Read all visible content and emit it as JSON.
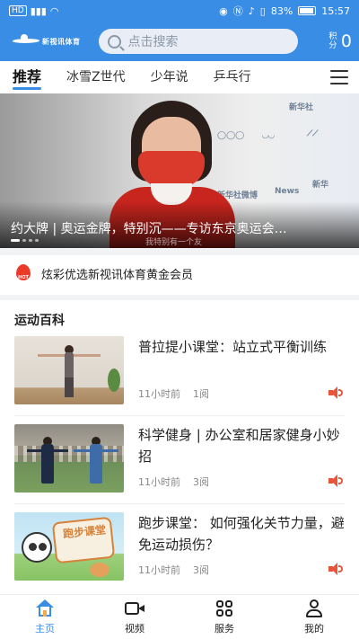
{
  "status_bar": {
    "left_icons": "HD",
    "battery": "83%",
    "time": "15:57"
  },
  "header": {
    "logo_text": "新视讯体育",
    "search_placeholder": "点击搜索",
    "points_label": "积分",
    "points_value": "0"
  },
  "tabs": [
    {
      "label": "推荐",
      "active": true
    },
    {
      "label": "冰雪Z世代",
      "active": false
    },
    {
      "label": "少年说",
      "active": false
    },
    {
      "label": "乒乓行",
      "active": false
    }
  ],
  "banner": {
    "title": "约大牌 | 奥运金牌，特别沉——专访东京奥运会…",
    "caption": "我特别有一个友",
    "total_slides": 4,
    "active_slide": 1
  },
  "promo": {
    "badge": "HOT",
    "text": "炫彩优选新视讯体育黄金会员"
  },
  "section": {
    "title": "运动百科"
  },
  "news": [
    {
      "title": "普拉提小课堂：站立式平衡训练",
      "time": "11小时前",
      "reads": "1阅",
      "thumb_text": ""
    },
    {
      "title": "科学健身 | 办公室和居家健身小妙招",
      "time": "11小时前",
      "reads": "3阅",
      "thumb_text": ""
    },
    {
      "title": "跑步课堂： 如何强化关节力量，避免运动损伤？",
      "time": "11小时前",
      "reads": "3阅",
      "thumb_text": "跑步课堂"
    }
  ],
  "bottom_nav": [
    {
      "label": "主页",
      "icon": "home-icon",
      "active": true
    },
    {
      "label": "视频",
      "icon": "video-icon",
      "active": false
    },
    {
      "label": "服务",
      "icon": "grid-icon",
      "active": false
    },
    {
      "label": "我的",
      "icon": "user-icon",
      "active": false
    }
  ],
  "colors": {
    "brand": "#3a8de5",
    "hot": "#ec3a2a",
    "speaker": "#e8553a"
  }
}
